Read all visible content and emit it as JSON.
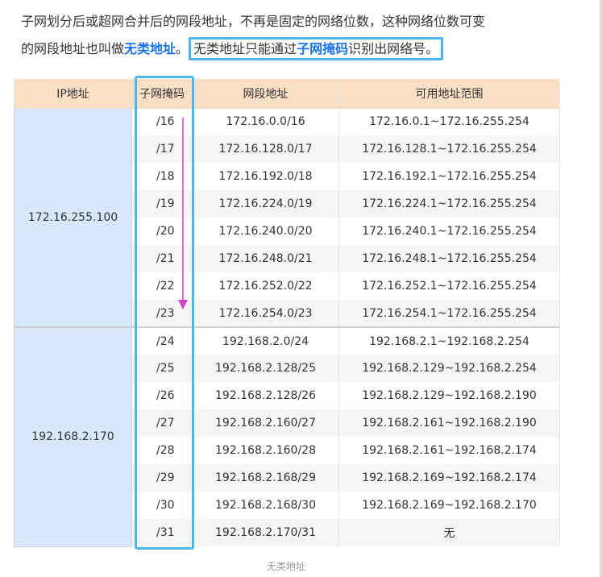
{
  "paragraph": {
    "line1": "子网划分后或超网合并后的网段地址，不再是固定的网络位数，这种网络位数可变",
    "line2_a": "的网段地址也叫做",
    "line2_term": "无类地址",
    "line2_b": "。",
    "boxed_a": "无类地址只能通过",
    "boxed_term": "子网掩码",
    "boxed_b": "识别出网络号。"
  },
  "table": {
    "headers": [
      "IP地址",
      "子网掩码",
      "网段地址",
      "可用地址范围"
    ],
    "groups": [
      {
        "ip": "172.16.255.100",
        "rows": [
          {
            "mask": "/16",
            "network": "172.16.0.0/16",
            "range": "172.16.0.1~172.16.255.254"
          },
          {
            "mask": "/17",
            "network": "172.16.128.0/17",
            "range": "172.16.128.1~172.16.255.254"
          },
          {
            "mask": "/18",
            "network": "172.16.192.0/18",
            "range": "172.16.192.1~172.16.255.254"
          },
          {
            "mask": "/19",
            "network": "172.16.224.0/19",
            "range": "172.16.224.1~172.16.255.254"
          },
          {
            "mask": "/20",
            "network": "172.16.240.0/20",
            "range": "172.16.240.1~172.16.255.254"
          },
          {
            "mask": "/21",
            "network": "172.16.248.0/21",
            "range": "172.16.248.1~172.16.255.254"
          },
          {
            "mask": "/22",
            "network": "172.16.252.0/22",
            "range": "172.16.252.1~172.16.255.254"
          },
          {
            "mask": "/23",
            "network": "172.16.254.0/23",
            "range": "172.16.254.1~172.16.255.254"
          }
        ]
      },
      {
        "ip": "192.168.2.170",
        "rows": [
          {
            "mask": "/24",
            "network": "192.168.2.0/24",
            "range": "192.168.2.1~192.168.2.254"
          },
          {
            "mask": "/25",
            "network": "192.168.2.128/25",
            "range": "192.168.2.129~192.168.2.254"
          },
          {
            "mask": "/26",
            "network": "192.168.2.128/26",
            "range": "192.168.2.129~192.168.2.190"
          },
          {
            "mask": "/27",
            "network": "192.168.2.160/27",
            "range": "192.168.2.161~192.168.2.190"
          },
          {
            "mask": "/28",
            "network": "192.168.2.160/28",
            "range": "192.168.2.161~192.168.2.174"
          },
          {
            "mask": "/29",
            "network": "192.168.2.168/29",
            "range": "192.168.2.169~192.168.2.174"
          },
          {
            "mask": "/30",
            "network": "192.168.2.168/30",
            "range": "192.168.2.169~192.168.2.170"
          },
          {
            "mask": "/31",
            "network": "192.168.2.170/31",
            "range": "无"
          }
        ]
      }
    ]
  },
  "caption": "无类地址",
  "colors": {
    "header_bg": "#fbe0c6",
    "ip_cell_bg": "#d9e7fb",
    "highlight_box": "#4db8f0",
    "term_text": "#1a73e8",
    "arrow": "#cc44cc"
  }
}
